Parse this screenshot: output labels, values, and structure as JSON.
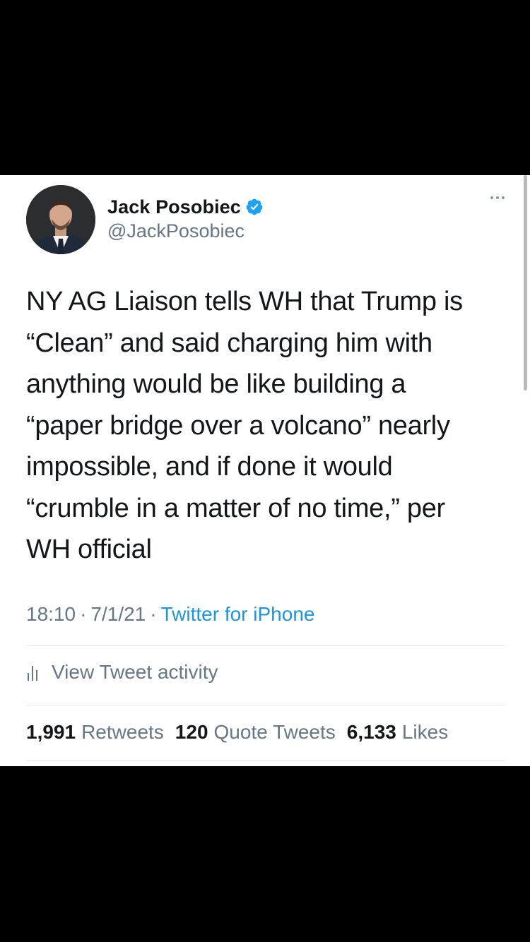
{
  "tweet": {
    "author": {
      "display_name": "Jack Posobiec",
      "handle": "@JackPosobiec",
      "verified": true
    },
    "text": "NY AG Liaison tells WH that Trump is\n“Clean” and said charging him with\nanything would be like building a\n“paper bridge over a volcano” nearly\nimpossible, and if done it would\n“crumble in a matter of no time,” per\nWH official",
    "time": "18:10",
    "date": "7/1/21",
    "separator": "·",
    "source": "Twitter for iPhone",
    "activity_label": "View Tweet activity",
    "stats": {
      "retweets_count": "1,991",
      "retweets_label": "Retweets",
      "quotes_count": "120",
      "quotes_label": "Quote Tweets",
      "likes_count": "6,133",
      "likes_label": "Likes"
    }
  },
  "colors": {
    "text_primary": "#14171a",
    "text_secondary": "#657786",
    "link": "#1b95e0",
    "verified_badge": "#1da1f2",
    "divider": "#e1e8ed"
  },
  "icons": [
    "avatar",
    "verified-badge-icon",
    "more-options-icon",
    "bar-chart-icon"
  ]
}
